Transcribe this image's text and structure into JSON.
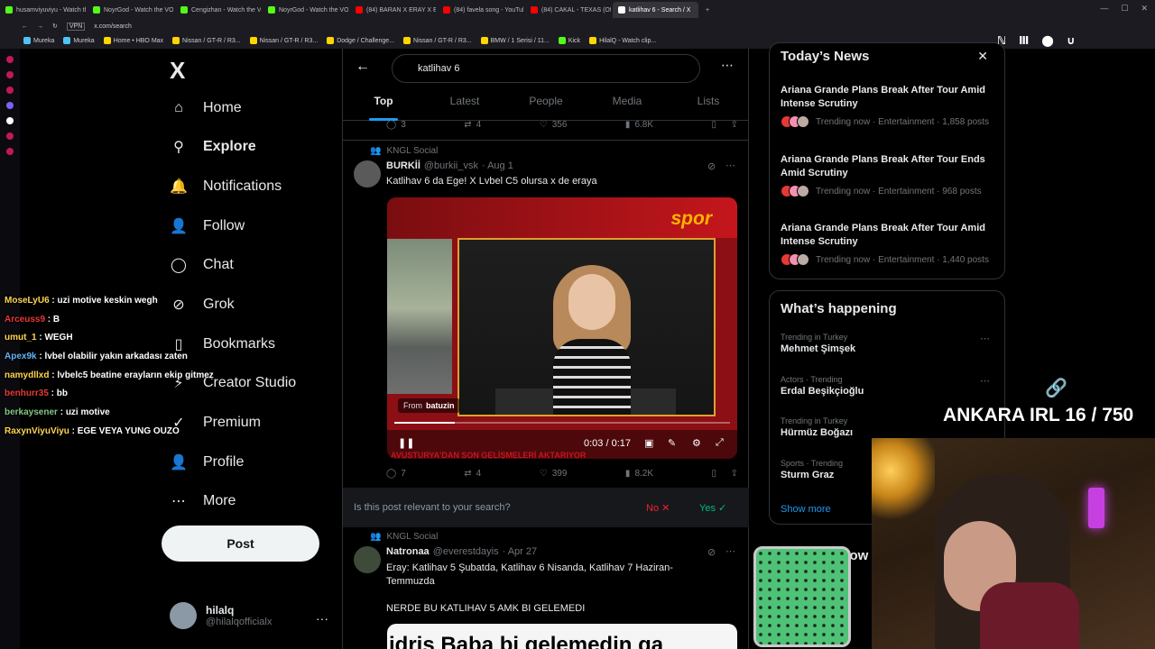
{
  "browser": {
    "tabs": [
      {
        "label": "husamviyuviyu - Watch the",
        "color": "#53fc18"
      },
      {
        "label": "NoyrGod - Watch the VOD",
        "color": "#53fc18"
      },
      {
        "label": "Cengizhan - Watch the VO",
        "color": "#53fc18"
      },
      {
        "label": "NoyrGod - Watch the VOD",
        "color": "#53fc18"
      },
      {
        "label": "(84) BARAN X ERAY X EB",
        "color": "#ff0000"
      },
      {
        "label": "(84) favela song - YouTube",
        "color": "#ff0000"
      },
      {
        "label": "(84) CAKAL - TEXAS (Offi",
        "color": "#ff0000"
      },
      {
        "label": "katlihav 6 - Search / X",
        "color": "#ffffff"
      }
    ],
    "url": "x.com/search",
    "url_badge": "VPN",
    "bookmarks": [
      "Mureka",
      "Mureka",
      "Home • HBO Max",
      "Nissan / GT-R / R3...",
      "Nissan / GT-R / R3...",
      "Dodge / Challenge...",
      "Nissan / GT-R / R3...",
      "BMW / 1 Serisi / 11...",
      "Kick",
      "HilalQ - Watch clip..."
    ]
  },
  "sidebar": {
    "logo": "X",
    "items": [
      {
        "label": "Home",
        "icon": "home-icon",
        "glyph": "⌂"
      },
      {
        "label": "Explore",
        "icon": "search-icon",
        "glyph": "⚲",
        "active": true
      },
      {
        "label": "Notifications",
        "icon": "bell-icon",
        "glyph": "🔔"
      },
      {
        "label": "Follow",
        "icon": "add-person-icon",
        "glyph": "👤"
      },
      {
        "label": "Chat",
        "icon": "chat-icon",
        "glyph": "◯"
      },
      {
        "label": "Grok",
        "icon": "grok-icon",
        "glyph": "⊘"
      },
      {
        "label": "Bookmarks",
        "icon": "bookmark-icon",
        "glyph": "▯"
      },
      {
        "label": "Creator Studio",
        "icon": "lightning-icon",
        "glyph": "⚡"
      },
      {
        "label": "Premium",
        "icon": "premium-icon",
        "glyph": "✓"
      },
      {
        "label": "Profile",
        "icon": "profile-icon",
        "glyph": "👤"
      },
      {
        "label": "More",
        "icon": "more-circle-icon",
        "glyph": "⋯"
      }
    ],
    "post_button": "Post",
    "account": {
      "name": "hilalq",
      "handle": "@hilalqofficialx",
      "more": "···"
    }
  },
  "search": {
    "query": "katlihav 6",
    "tabs": [
      "Top",
      "Latest",
      "People",
      "Media",
      "Lists"
    ],
    "active_tab": "Top"
  },
  "prev_actions": {
    "replies": "3",
    "reposts": "4",
    "likes": "356",
    "views": "6.8K"
  },
  "tweet1": {
    "context": "KNGL Social",
    "name": "BURKİİ",
    "handle": "@burkii_vsk",
    "date": "· Aug 1",
    "text": "Katlihav 6 da Ege! X Lvbel C5 olursa x de eraya",
    "video": {
      "brand": "spor",
      "from_label": "From",
      "from_user": "batuzin",
      "time": "0:03 / 0:17",
      "progress": 0.18,
      "ticker": "AVUSTURYA'DAN SON GELİŞMELERİ AKTARIYOR"
    },
    "actions": {
      "replies": "7",
      "reposts": "4",
      "likes": "399",
      "views": "8.2K"
    }
  },
  "relevance": {
    "question": "Is this post relevant to your search?",
    "no": "No ✕",
    "yes": "Yes ✓"
  },
  "tweet2": {
    "context": "KNGL Social",
    "name": "Natronaa",
    "handle": "@everestdayis",
    "date": "· Apr 27",
    "text_line1": "Eray: Katlihav 5 Şubatda, Katlihav 6 Nisanda, Katlihav 7  Haziran-",
    "text_line2": "Temmuzda",
    "text_line3": "NERDE BU KATLIHAV 5 AMK BI GELEMEDI",
    "image_text": "idris Baba bi gelemedin ga"
  },
  "news": {
    "title": "Today’s News",
    "items": [
      {
        "headline": "Ariana Grande Plans Break After Tour Amid Intense Scrutiny",
        "meta": "Trending now · Entertainment · 1,858 posts"
      },
      {
        "headline": "Ariana Grande Plans Break After Tour Ends Amid Scrutiny",
        "meta": "Trending now · Entertainment · 968 posts"
      },
      {
        "headline": "Ariana Grande Plans Break After Tour Amid Intense Scrutiny",
        "meta": "Trending now · Entertainment · 1,440 posts"
      }
    ]
  },
  "happening": {
    "title": "What’s happening",
    "trends": [
      {
        "context": "Trending in Turkey",
        "topic": "Mehmet Şimşek"
      },
      {
        "context": "Actors · Trending",
        "topic": "Erdal Beşikçioğlu"
      },
      {
        "context": "Trending in Turkey",
        "topic": "Hürmüz Boğazı"
      },
      {
        "context": "Sports · Trending",
        "topic": "Sturm Graz"
      }
    ],
    "show_more": "Show more"
  },
  "who_to_follow": "Who to follow",
  "overlay": {
    "chat": [
      {
        "user": "MoseLyU6",
        "msg": "uzi motive keskin wegh",
        "color": "#ffd54f"
      },
      {
        "user": "Arceuss9",
        "msg": "B",
        "color": "#e53935"
      },
      {
        "user": "umut_1",
        "msg": "WEGH",
        "color": "#ffd54f"
      },
      {
        "user": "Apex9k",
        "msg": "lvbel olabilir yakın arkadası zaten",
        "color": "#64b5f6"
      },
      {
        "user": "namydllxd",
        "msg": "lvbelc5 beatine erayların ekip gitmez",
        "color": "#ffd54f"
      },
      {
        "user": "benhurr35",
        "msg": "bb",
        "color": "#e53935"
      },
      {
        "user": "berkaysener",
        "msg": "uzi motive",
        "color": "#81c784"
      },
      {
        "user": "RaxynViyuViyu",
        "msg": "EGE VEYA YUNG OUZO",
        "color": "#ffd54f"
      }
    ],
    "irl_counter": "ANKARA IRL 16 / 750"
  }
}
